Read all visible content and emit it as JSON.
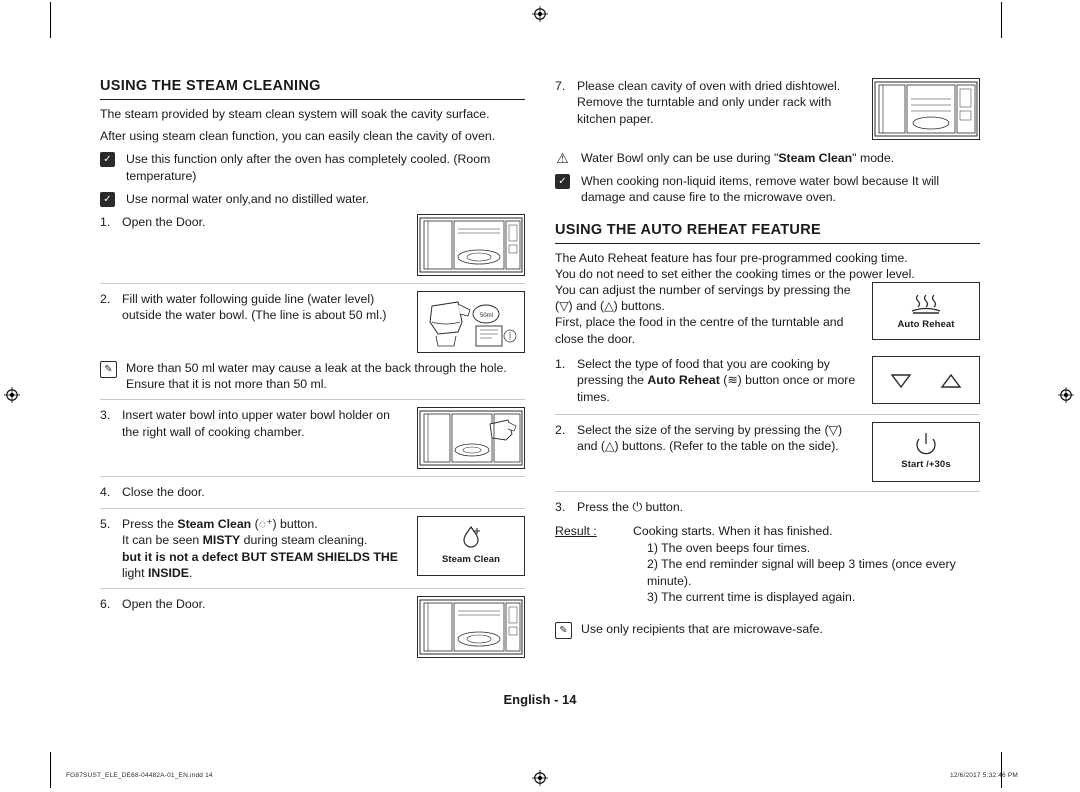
{
  "document": {
    "page_label": "English - 14",
    "footer_left": "FG87SUST_ELE_DE68-04482A-01_EN.indd   14",
    "footer_right": "12/6/2017   5:32:46 PM"
  },
  "left_column": {
    "title": "USING THE STEAM CLEANING",
    "intro_1": "The steam provided by steam clean system will soak the cavity surface.",
    "intro_2": "After using steam clean function, you can easily clean the cavity of oven.",
    "note_1": "Use this function only after the oven has completely cooled. (Room temperature)",
    "note_2": "Use normal water only,and no distilled water.",
    "steps": [
      {
        "num": "1.",
        "text": "Open the Door.",
        "illustration": "oven-open-door"
      },
      {
        "num": "2.",
        "text": "Fill with water following guide line (water level) outside the water bowl. (The line is about 50 ml.)",
        "illustration": "water-bowl-fill"
      },
      {
        "num": "3.",
        "text": "Insert water bowl into upper water bowl holder on the right wall of cooking chamber.",
        "illustration": "oven-insert-bowl"
      },
      {
        "num": "4.",
        "text": "Close the door.",
        "illustration": ""
      },
      {
        "num": "5.",
        "text": "Press the Steam Clean ( ) button.",
        "illustration": "steam-clean-button"
      },
      {
        "num": "6.",
        "text": "Open the Door.",
        "illustration": "oven-open-door"
      }
    ],
    "step2_note": "More than 50 ml water may cause a leak at the back through the hole. Ensure that it is not more than 50 ml.",
    "step5_line1_prefix": "Press the ",
    "step5_bold": "Steam Clean",
    "step5_line1_suffix": ") button.",
    "step5_line2": "It can be seen MISTY during steam cleaning.",
    "step5_line3": "but it is not a defect BUT STEAM SHIELDS THE",
    "step5_line4": "light INSIDE.",
    "steam_clean_panel_label": "Steam Clean"
  },
  "right_column": {
    "step7": {
      "num": "7.",
      "line1": "Please clean cavity of oven with dried dishtowel.",
      "line2": "Remove the turntable and only under rack with kitchen paper."
    },
    "warning_note": "Water Bowl only can be use during \"Steam Clean\" mode.",
    "info_note": "When cooking non-liquid items, remove water bowl because It will damage and cause fire to the microwave oven.",
    "title": "USING THE AUTO REHEAT FEATURE",
    "intro_1": "The Auto Reheat feature has four pre-programmed cooking time.",
    "intro_2": "You do not need to set either the cooking times or the power level.",
    "intro_3": "You can adjust the number of servings by pressing the (  ) and (  ) buttons.",
    "intro_4": "First, place the food in the centre of the turntable and close the door.",
    "auto_reheat_panel_label": "Auto Reheat",
    "start_panel_label": "Start /+30s",
    "steps": [
      {
        "num": "1.",
        "text": "Select the type of food that you are cooking by pressing the Auto Reheat ( ) button once or more times."
      },
      {
        "num": "2.",
        "text": "Select the size of the serving by pressing the (  ) and (  ) buttons. (Refer to the table on the side)."
      },
      {
        "num": "3.",
        "text": "Press the   button."
      }
    ],
    "result_label": "Result :",
    "result_intro": "Cooking starts. When it has finished.",
    "results": [
      "1) The oven beeps four times.",
      "2) The end reminder signal will beep 3 times (once every minute).",
      "3) The current time is displayed again."
    ],
    "final_note": "Use only recipients that are microwave-safe."
  }
}
